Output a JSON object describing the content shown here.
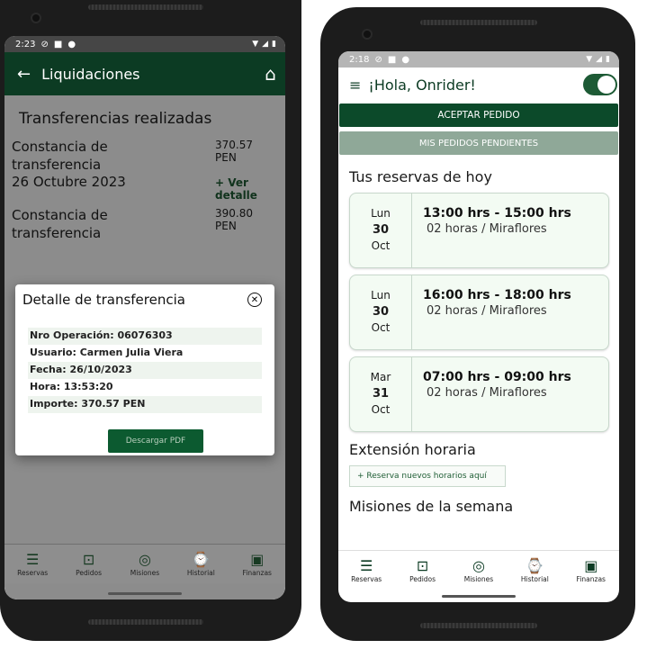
{
  "left": {
    "status": {
      "time": "2:23"
    },
    "appbar": {
      "title": "Liquidaciones"
    },
    "section_title": "Transferencias realizadas",
    "transfers": [
      {
        "line1": "Constancia de",
        "line2": "transferencia",
        "line3": "26 Octubre 2023",
        "amount": "370.57",
        "currency": "PEN",
        "link": "+ Ver detalle"
      },
      {
        "line1": "Constancia de",
        "line2": "transferencia",
        "line3": "",
        "amount": "390.80",
        "currency": "PEN",
        "link": ""
      }
    ],
    "dialog": {
      "title": "Detalle de transferencia",
      "rows": [
        "Nro Operación: 06076303",
        "Usuario: Carmen Julia Viera",
        "Fecha: 26/10/2023",
        "Hora: 13:53:20",
        "Importe: 370.57 PEN"
      ],
      "download_label": "Descargar PDF"
    }
  },
  "right": {
    "status": {
      "time": "2:18"
    },
    "greeting": "¡Hola, Onrider!",
    "accept_label": "ACEPTAR PEDIDO",
    "pending_label": "MIS PEDIDOS PENDIENTES",
    "reservations_title": "Tus reservas de hoy",
    "reservations": [
      {
        "weekday": "Lun",
        "day": "30",
        "month": "Oct",
        "time": "13:00 hrs - 15:00 hrs",
        "place": "02 horas / Miraflores"
      },
      {
        "weekday": "Lun",
        "day": "30",
        "month": "Oct",
        "time": "16:00 hrs - 18:00 hrs",
        "place": "02 horas / Miraflores"
      },
      {
        "weekday": "Mar",
        "day": "31",
        "month": "Oct",
        "time": "07:00 hrs - 09:00 hrs",
        "place": "02 horas / Miraflores"
      }
    ],
    "extension_title": "Extensión horaria",
    "extension_link": "+ Reserva nuevos horarios aquí",
    "missions_title": "Misiones de la semana"
  },
  "nav": [
    {
      "label": "Reservas",
      "icon": "list-icon"
    },
    {
      "label": "Pedidos",
      "icon": "bag-icon"
    },
    {
      "label": "Misiones",
      "icon": "target-icon"
    },
    {
      "label": "Historial",
      "icon": "clipboard-clock-icon"
    },
    {
      "label": "Finanzas",
      "icon": "cash-icon"
    }
  ],
  "colors": {
    "brand": "#0c3b23",
    "accent": "#1f5e35",
    "card_bg": "#f3fbf3"
  }
}
